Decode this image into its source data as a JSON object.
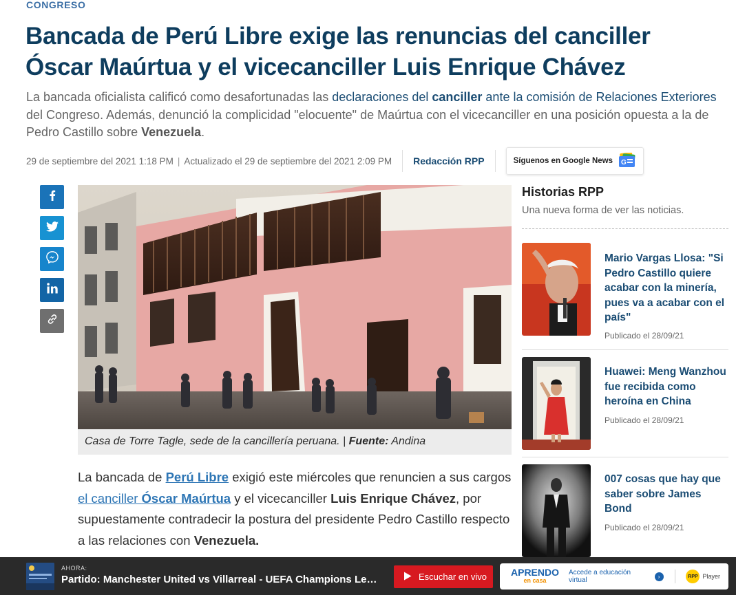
{
  "section": "CONGRESO",
  "headline": "Bancada de Perú Libre exige las renuncias del canciller Óscar Maúrtua y el vicecanciller Luis Enrique Chávez",
  "lead": {
    "p1": "La bancada oficialista calificó como desafortunadas las ",
    "link1": "declaraciones del ",
    "link1_bold": "canciller",
    "p2": " ",
    "link2": "ante la comisión de Relaciones Exteriores",
    "p3": " del Congreso. Además, denunció la complicidad \"elocuente\" de Maúrtua con el vicecanciller en una posición opuesta a la de Pedro Castillo sobre ",
    "bold_end": "Venezuela",
    "p4": "."
  },
  "meta": {
    "published": "29 de septiembre del 2021 1:18 PM",
    "separator": "|",
    "updated": "Actualizado el 29 de septiembre del 2021 2:09 PM",
    "author": "Redacción RPP",
    "google_news": "Síguenos en Google News"
  },
  "share": [
    {
      "name": "share-facebook-button",
      "icon": "facebook-icon"
    },
    {
      "name": "share-twitter-button",
      "icon": "twitter-icon"
    },
    {
      "name": "share-messenger-button",
      "icon": "messenger-icon"
    },
    {
      "name": "share-linkedin-button",
      "icon": "linkedin-icon"
    },
    {
      "name": "copy-link-button",
      "icon": "link-icon"
    }
  ],
  "caption": {
    "text": "Casa de Torre Tagle, sede de la cancillería peruana. | ",
    "source_label": "Fuente:",
    "source": " Andina"
  },
  "body": {
    "t1": "La bancada de ",
    "link1": "Perú Libre",
    "t2": " exigió este miércoles que renuncien a sus cargos ",
    "link2a": "el canciller ",
    "link2b": "Óscar Maúrtua",
    "t3": " y el vicecanciller ",
    "bold1": "Luis Enrique Chávez",
    "t4": ", por supuestamente contradecir la postura del presidente Pedro Castillo respecto a las relaciones con ",
    "bold2": "Venezuela."
  },
  "sidebar": {
    "title": "Historias RPP",
    "subtitle": "Una nueva forma de ver las noticias.",
    "stories": [
      {
        "title": "Mario Vargas Llosa: \"Si Pedro Castillo quiere acabar con la minería, pues va a acabar con el país\"",
        "date": "Publicado el 28/09/21"
      },
      {
        "title": "Huawei: Meng Wanzhou fue recibida como heroína en China",
        "date": "Publicado el 28/09/21"
      },
      {
        "title": "007 cosas que hay que saber sobre James Bond",
        "date": "Publicado el 28/09/21"
      }
    ]
  },
  "player": {
    "now_label": "AHORA:",
    "title": "Partido: Manchester United vs Villarreal - UEFA Champions League",
    "listen_label": "Escuchar en vivo",
    "aprendo_main": "APRENDO",
    "aprendo_sub": "en casa",
    "aprendo_cta": "Accede a educación virtual",
    "rpp_badge": "RPP",
    "rpp_player": "Player"
  },
  "colors": {
    "headline": "#0e3d5e",
    "link": "#2e76b5",
    "facebook": "#1a73b8",
    "twitter": "#1792d2",
    "linkedin": "#1365a6",
    "listen_button": "#d71920"
  }
}
